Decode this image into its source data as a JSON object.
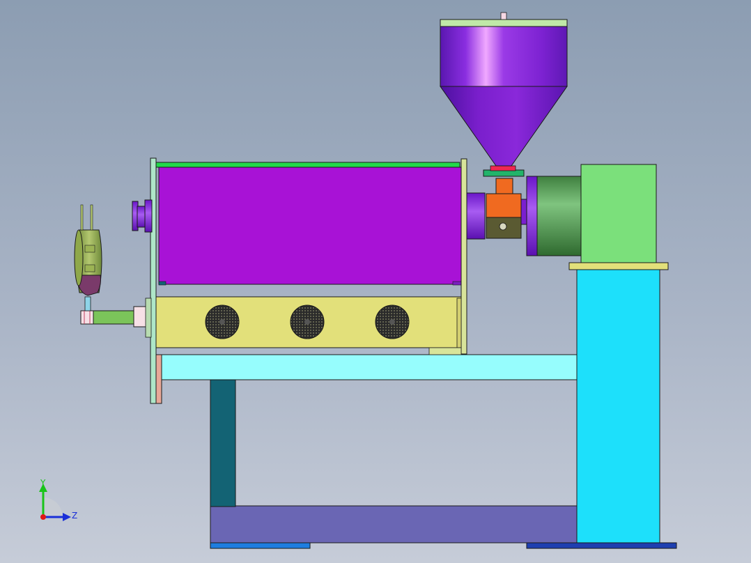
{
  "axes": {
    "y_label": "Y",
    "z_label": "Z",
    "y_color": "#19c419",
    "z_color": "#1a2fd8",
    "x_color": "#e01818"
  },
  "colors": {
    "background_top": "#8c9db2",
    "background_bottom": "#c6ccd8",
    "hopper": "#8a1fd6",
    "barrel_housing": "#a812d6",
    "heater_box": "#e2e07a",
    "frame_cyan": "#1de0fb",
    "frame_light_cyan": "#96fdfd",
    "base_plate": "#6a66b4",
    "leg_teal": "#136374",
    "gearbox_green": "#7be07b",
    "motor_green": "#4f9a4f",
    "feed_throat_orange": "#f06a20",
    "edge": "#1a1a1a"
  }
}
